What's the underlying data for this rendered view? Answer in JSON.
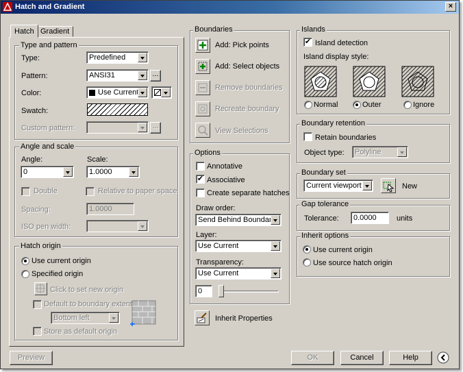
{
  "window": {
    "title": "Hatch and Gradient",
    "close_label": "×"
  },
  "tabs": [
    {
      "label": "Hatch"
    },
    {
      "label": "Gradient"
    }
  ],
  "type_pattern": {
    "title": "Type and pattern",
    "type_label": "Type:",
    "type_value": "Predefined",
    "pattern_label": "Pattern:",
    "pattern_value": "ANSI31",
    "color_label": "Color:",
    "color_value": "Use Current",
    "swatch_label": "Swatch:",
    "custom_label": "Custom pattern:",
    "browse_label": "..."
  },
  "angle_scale": {
    "title": "Angle and scale",
    "angle_label": "Angle:",
    "angle_value": "0",
    "scale_label": "Scale:",
    "scale_value": "1.0000",
    "double_label": "Double",
    "relative_label": "Relative to paper space",
    "spacing_label": "Spacing:",
    "spacing_value": "1.0000",
    "iso_label": "ISO pen width:"
  },
  "hatch_origin": {
    "title": "Hatch origin",
    "use_current": "Use current origin",
    "specified": "Specified origin",
    "click_to_set": "Click to set new origin",
    "default_extents": "Default to boundary extents",
    "extents_value": "Bottom left",
    "store_default": "Store as default origin"
  },
  "boundaries": {
    "title": "Boundaries",
    "add_pick": "Add: Pick points",
    "add_select": "Add: Select objects",
    "remove": "Remove boundaries",
    "recreate": "Recreate boundary",
    "view": "View Selections"
  },
  "options": {
    "title": "Options",
    "annotative": "Annotative",
    "associative": "Associative",
    "separate": "Create separate hatches",
    "draw_order_label": "Draw order:",
    "draw_order_value": "Send Behind Boundary",
    "layer_label": "Layer:",
    "layer_value": "Use Current",
    "transparency_label": "Transparency:",
    "transparency_value": "Use Current",
    "transparency_amount": "0"
  },
  "inherit": {
    "label": "Inherit Properties"
  },
  "islands": {
    "title": "Islands",
    "detection": "Island detection",
    "style_label": "Island display style:",
    "normal": "Normal",
    "outer": "Outer",
    "ignore": "Ignore"
  },
  "boundary_retention": {
    "title": "Boundary retention",
    "retain": "Retain boundaries",
    "object_type_label": "Object type:",
    "object_type_value": "Polyline"
  },
  "boundary_set": {
    "title": "Boundary set",
    "value": "Current viewport",
    "new_label": "New"
  },
  "gap": {
    "title": "Gap tolerance",
    "tolerance_label": "Tolerance:",
    "tolerance_value": "0.0000",
    "units": "units"
  },
  "inherit_options": {
    "title": "Inherit options",
    "use_current": "Use current origin",
    "use_source": "Use source hatch origin"
  },
  "footer": {
    "preview": "Preview",
    "ok": "OK",
    "cancel": "Cancel",
    "help": "Help"
  },
  "colors": {
    "title_start": "#0a246a",
    "title_end": "#a6caf0",
    "dialog_bg": "#d4d0c8"
  }
}
